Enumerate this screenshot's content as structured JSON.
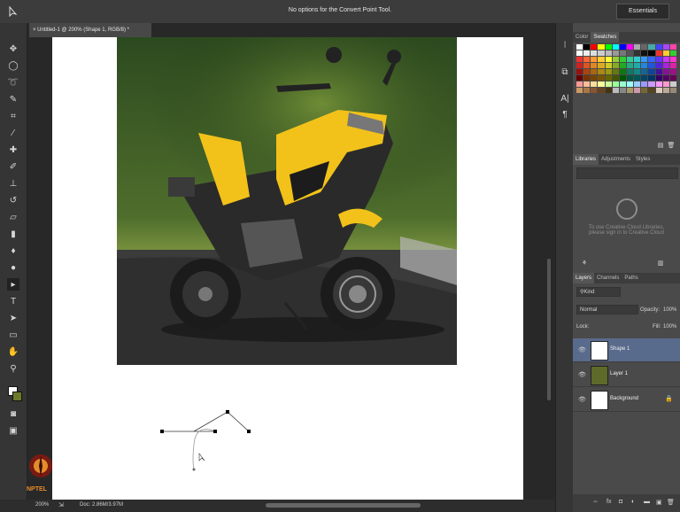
{
  "app": {
    "options_message": "No options for the Convert Point Tool.",
    "workspace": "Essentials",
    "document_tab": "Untitled-1 @ 200% (Shape 1, RGB/8) *",
    "zoom": "200%",
    "doc_size": "Doc: 2.86M/3.97M"
  },
  "toolbox": {
    "icons": [
      "move-tool-icon",
      "marquee-tool-icon",
      "lasso-tool-icon",
      "quick-select-tool-icon",
      "crop-tool-icon",
      "eyedropper-tool-icon",
      "healing-brush-icon",
      "brush-tool-icon",
      "clone-stamp-icon",
      "history-brush-icon",
      "eraser-tool-icon",
      "gradient-tool-icon",
      "blur-tool-icon",
      "dodge-tool-icon",
      "pen-tool-icon",
      "type-tool-icon",
      "path-select-icon",
      "rectangle-tool-icon",
      "hand-tool-icon",
      "zoom-tool-icon"
    ]
  },
  "color_panel": {
    "tabs": [
      "Color",
      "Swatches"
    ],
    "active_tab": "Swatches"
  },
  "libraries_panel": {
    "tabs": [
      "Libraries",
      "Adjustments",
      "Styles"
    ],
    "message": "To use Creative Cloud Libraries, please sign in to Creative Cloud"
  },
  "layers_panel": {
    "tabs": [
      "Layers",
      "Channels",
      "Paths"
    ],
    "filter": "Kind",
    "blend_mode": "Normal",
    "opacity_label": "Opacity:",
    "opacity": "100%",
    "lock_label": "Lock:",
    "fill_label": "Fill:",
    "fill": "100%",
    "layers": [
      {
        "name": "Shape 1",
        "selected": true
      },
      {
        "name": "Layer 1",
        "selected": false
      },
      {
        "name": "Background",
        "selected": false
      }
    ]
  },
  "colors": {
    "selected_layer": "#596b8c",
    "accent_yellow": "#f2c21a"
  },
  "watermark": "NPTEL"
}
